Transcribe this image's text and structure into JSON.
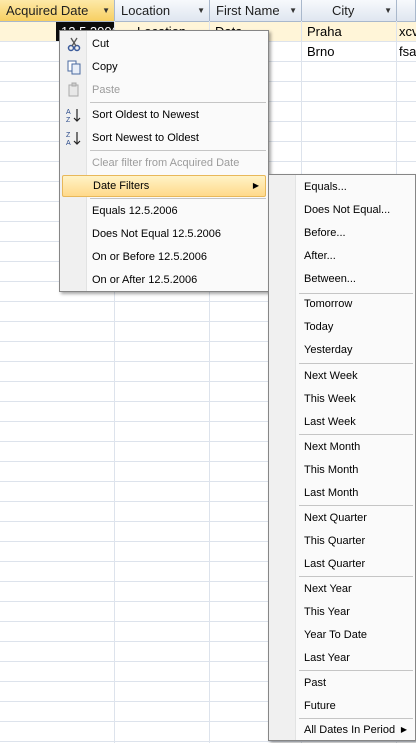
{
  "table": {
    "headers": [
      "Acquired Date",
      "Location",
      "First Name",
      "City",
      ""
    ],
    "rows": [
      [
        "12.5.2006",
        "Location",
        "Data",
        "Praha",
        "xcv"
      ],
      [
        "2",
        "",
        "",
        "Brno",
        "fsa"
      ]
    ]
  },
  "context_menu": {
    "cut": "Cut",
    "copy": "Copy",
    "paste": "Paste",
    "sort_oldest": "Sort Oldest to Newest",
    "sort_newest": "Sort Newest to Oldest",
    "clear_filter": "Clear filter from Acquired Date",
    "date_filters": "Date Filters",
    "equals": "Equals 12.5.2006",
    "not_equal": "Does Not Equal 12.5.2006",
    "on_or_before": "On or Before 12.5.2006",
    "on_or_after": "On or After 12.5.2006"
  },
  "date_filters_menu": {
    "items": [
      "Equals...",
      "Does Not Equal...",
      "Before...",
      "After...",
      "Between...",
      "Tomorrow",
      "Today",
      "Yesterday",
      "Next Week",
      "This Week",
      "Last Week",
      "Next Month",
      "This Month",
      "Last Month",
      "Next Quarter",
      "This Quarter",
      "Last Quarter",
      "Next Year",
      "This Year",
      "Year To Date",
      "Last Year",
      "Past",
      "Future",
      "All Dates In Period"
    ]
  },
  "colors": {
    "active_header": "#f7cf62",
    "menu_hover": "#ffd98a",
    "selected_cell": "#0b0b0b"
  }
}
